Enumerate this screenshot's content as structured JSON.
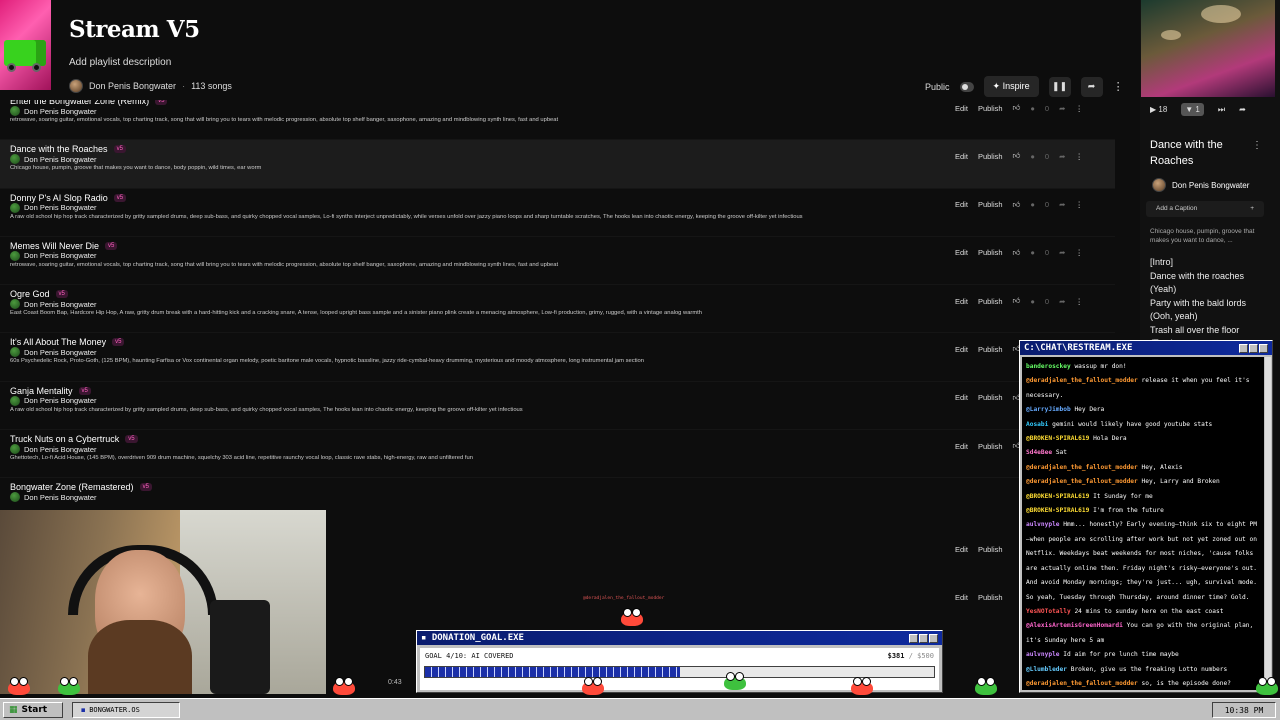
{
  "playlist": {
    "title": "Stream V5",
    "description": "Add playlist description",
    "owner": "Don Penis Bongwater",
    "song_count": "113 songs",
    "visibility": "Public",
    "inspire_label": "Inspire",
    "pause_glyph": "❚❚",
    "share_glyph": "➦",
    "more_glyph": "⋮"
  },
  "row_actions": {
    "edit": "Edit",
    "publish": "Publish",
    "likes": "0"
  },
  "songs": [
    {
      "title": "Enter the Bongwater Zone (Remix)",
      "version": "v5",
      "artist": "Don Penis Bongwater",
      "desc": "retrowave, soaring guitar, emotional vocals, top charting track, song that will bring you to tears with melodic progression, absolute top shelf banger, saxophone, amazing and mindblowing synth lines, fast and upbeat"
    },
    {
      "title": "Dance with the Roaches",
      "version": "v5",
      "artist": "Don Penis Bongwater",
      "desc": "Chicago house, pumpin, groove that makes you want to dance, body poppin, wild times, ear worm"
    },
    {
      "title": "Donny P's AI Slop Radio",
      "version": "v5",
      "artist": "Don Penis Bongwater",
      "desc": "A raw old school hip hop track characterized by gritty sampled drums, deep sub-bass, and quirky chopped vocal samples, Lo-fi synths interject unpredictably, while verses unfold over jazzy piano loops and sharp turntable scratches, The hooks lean into chaotic energy, keeping the groove off-kilter yet infectious"
    },
    {
      "title": "Memes Will Never Die",
      "version": "v5",
      "artist": "Don Penis Bongwater",
      "desc": "retrowave, soaring guitar, emotional vocals, top charting track, song that will bring you to tears with melodic progression, absolute top shelf banger, saxophone, amazing and mindblowing synth lines, fast and upbeat"
    },
    {
      "title": "Ogre God",
      "version": "v5",
      "artist": "Don Penis Bongwater",
      "desc": "East Coast Boom Bap, Hardcore Hip Hop, A raw, gritty drum break with a hard-hitting kick and a cracking snare, A tense, looped upright bass sample and a sinister piano plink create a menacing atmosphere, Low-fi production, grimy, rugged, with a vintage analog warmth"
    },
    {
      "title": "It's All About The Money",
      "version": "v5",
      "artist": "Don Penis Bongwater",
      "desc": "60s Psychedelic Rock, Proto-Goth, (125 BPM), haunting Farfisa or Vox continental organ melody, poetic baritone male vocals, hypnotic bassline, jazzy ride-cymbal-heavy drumming, mysterious and moody atmosphere, long instrumental jam section"
    },
    {
      "title": "Ganja Mentality",
      "version": "v5",
      "artist": "Don Penis Bongwater",
      "desc": "A raw old school hip hop track characterized by gritty sampled drums, deep sub-bass, and quirky chopped vocal samples, The hooks lean into chaotic energy, keeping the groove off-kilter yet infectious"
    },
    {
      "title": "Truck Nuts on a Cybertruck",
      "version": "v5",
      "artist": "Don Penis Bongwater",
      "desc": "Ghettotech, Lo-fi Acid House, (145 BPM), overdriven 909 drum machine, squelchy 303 acid line, repetitive raunchy vocal loop, classic rave stabs, high-energy, raw and unfiltered fun"
    },
    {
      "title": "Bongwater Zone (Remastered)",
      "version": "v5",
      "artist": "Don Penis Bongwater",
      "desc": ""
    }
  ],
  "now_playing": {
    "title": "Dance with the Roaches",
    "artist": "Don Penis Bongwater",
    "caption_placeholder": "Add a Caption",
    "description": "Chicago house, pumpin, groove that makes you want to dance, ...",
    "lyrics": [
      "[Intro]",
      "Dance with the roaches",
      "(Yeah)",
      "Party with the bald lords",
      "(Ooh, yeah)",
      "Trash all over the floor (Trash"
    ],
    "likes": "18",
    "dislikes": "1"
  },
  "chat": {
    "title": "C:\\CHAT\\RESTREAM.EXE",
    "messages": [
      {
        "user": "banderosckey",
        "text": "wassup mr don!",
        "color": "#66ff66"
      },
      {
        "user": "@deradjalen_the_fallout_modder",
        "text": "release it when you feel it's necessary.",
        "color": "#ff9a33"
      },
      {
        "user": "@LarryJimbob",
        "text": "Hey Dera",
        "color": "#66aaff"
      },
      {
        "user": "Aosabi",
        "text": "gemini would likely have good youtube stats",
        "color": "#33ccff"
      },
      {
        "user": "@BROKEN-SPIRAL619",
        "text": "Hola Dera",
        "color": "#ffdd33"
      },
      {
        "user": "Sd4eBee",
        "text": "Sat",
        "color": "#ff77cc"
      },
      {
        "user": "@deradjalen_the_fallout_modder",
        "text": "Hey, Alexis",
        "color": "#ff9a33"
      },
      {
        "user": "@deradjalen_the_fallout_modder",
        "text": "Hey, Larry and Broken",
        "color": "#ff9a33"
      },
      {
        "user": "@BROKEN-SPIRAL619",
        "text": "It Sunday for me",
        "color": "#ffdd33"
      },
      {
        "user": "@BROKEN-SPIRAL619",
        "text": "I'm from the future",
        "color": "#ffdd33"
      },
      {
        "user": "aulvnyple",
        "text": "Hmm... honestly? Early evening—think six to eight PM—when people are scrolling after work but not yet zoned out on Netflix. Weekdays beat weekends for most niches, 'cause folks are actually online then. Friday night's risky—everyone's out. And avoid Monday mornings; they're just... ugh, survival mode. So yeah, Tuesday through Thursday, around dinner time? Gold.",
        "color": "#cc88ff"
      },
      {
        "user": "YesNOTotally",
        "text": "24 mins to sunday here on the east coast",
        "color": "#ff5555"
      },
      {
        "user": "@AlexisArtemisGreenHomardi",
        "text": "You can go with the original plan, it's Sunday here 5 am",
        "color": "#ff66cc"
      },
      {
        "user": "aulvnyple",
        "text": "Id aim for pre lunch time maybe",
        "color": "#cc88ff"
      },
      {
        "user": "@Llumbleder",
        "text": "Broken, give us the freaking Lotto numbers",
        "color": "#66ccff"
      },
      {
        "user": "@deradjalen_the_fallout_modder",
        "text": "so, is the episode done?",
        "color": "#ff9a33"
      }
    ]
  },
  "donation": {
    "title": "DONATION_GOAL.EXE",
    "label": "GOAL 4/10: AI COVERED",
    "amount": "$381",
    "target": "/ $500",
    "progress": 0.5
  },
  "player": {
    "elapsed": "0:43"
  },
  "overlay_name": "@deradjalen_the_fallout_modder",
  "taskbar": {
    "start": "Start",
    "app": "BONGWATER.OS",
    "clock": "10:38 PM"
  },
  "colors": {
    "accent_pink": "#ff5fc0",
    "win_title": "#0e2a9e"
  }
}
